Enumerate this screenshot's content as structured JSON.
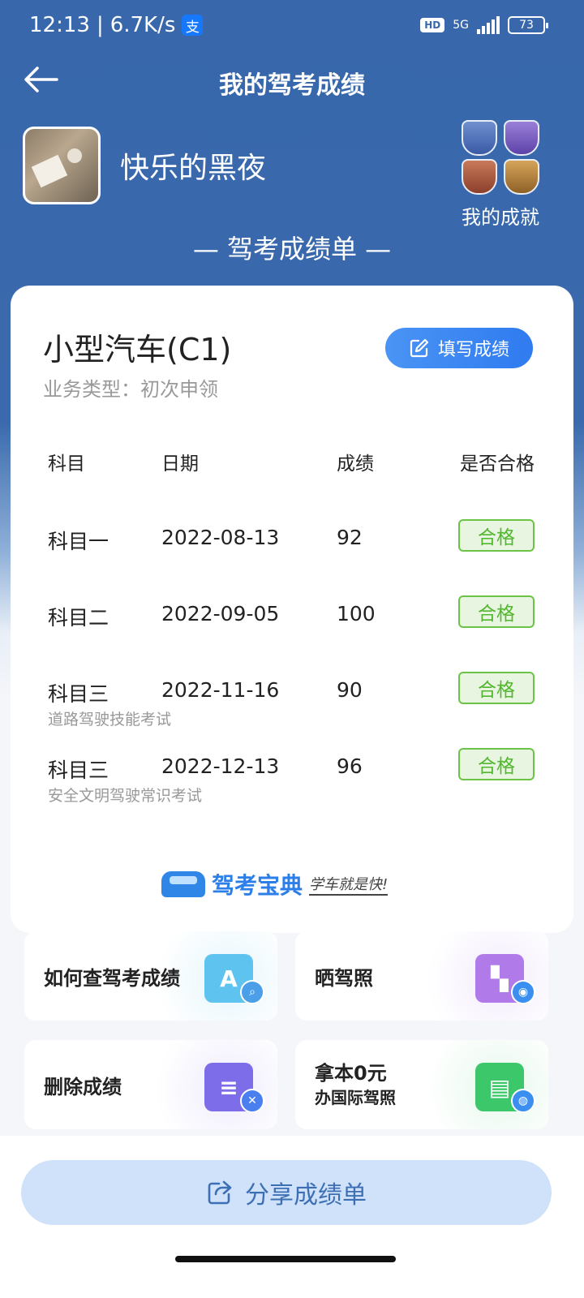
{
  "status": {
    "time": "12:13",
    "speed": "6.7K/s",
    "alipay_glyph": "支",
    "hd": "HD",
    "net": "5G",
    "battery": "73"
  },
  "nav": {
    "title": "我的驾考成绩"
  },
  "profile": {
    "username": "快乐的黑夜",
    "achievements_label": "我的成就"
  },
  "sheet": {
    "title": "— 驾考成绩单 —"
  },
  "card": {
    "car_type": "小型汽车(C1)",
    "business_type": "业务类型：初次申领",
    "fill_button": "填写成绩",
    "headers": [
      "科目",
      "日期",
      "成绩",
      "是否合格"
    ],
    "rows": [
      {
        "subject": "科目一",
        "date": "2022-08-13",
        "score": "92",
        "status": "合格",
        "note": ""
      },
      {
        "subject": "科目二",
        "date": "2022-09-05",
        "score": "100",
        "status": "合格",
        "note": ""
      },
      {
        "subject": "科目三",
        "date": "2022-11-16",
        "score": "90",
        "status": "合格",
        "note": "道路驾驶技能考试"
      },
      {
        "subject": "科目三",
        "date": "2022-12-13",
        "score": "96",
        "status": "合格",
        "note": "安全文明驾驶常识考试"
      }
    ],
    "brand": {
      "name": "驾考宝典",
      "slogan": "学车就是快!"
    }
  },
  "tiles": [
    {
      "label": "如何查驾考成绩",
      "icon": "search-doc-icon",
      "color": "#5fc3f0"
    },
    {
      "label": "晒驾照",
      "icon": "photo-share-icon",
      "color": "#b07ae8"
    },
    {
      "label": "删除成绩",
      "icon": "delete-doc-icon",
      "color": "#7d6de8"
    },
    {
      "label_line1": "拿本0元",
      "label_line2": "办国际驾照",
      "icon": "license-globe-icon",
      "color": "#3cc76a"
    }
  ],
  "share": {
    "label": "分享成绩单"
  }
}
